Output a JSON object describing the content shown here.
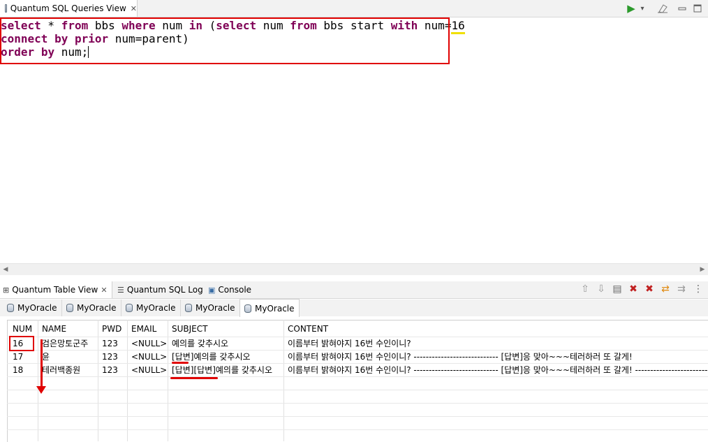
{
  "editor_tab": {
    "title": "Quantum SQL Queries View",
    "close": "✕"
  },
  "editor_toolbar": {
    "run": "▶",
    "dropdown": "▾",
    "clear": "🧹",
    "minimize": "▭",
    "maximize": "□"
  },
  "sql": {
    "line1": {
      "k1": "select",
      "t1": " * ",
      "k2": "from",
      "t2": " bbs ",
      "k3": "where",
      "t3": " num ",
      "k4": "in",
      "t4": " (",
      "k5": "select",
      "t5": " num ",
      "k6": "from",
      "t6": " bbs start ",
      "k7": "with",
      "t7": " num=",
      "num": "16"
    },
    "line2": {
      "k1": "connect",
      "t1": " ",
      "k2": "by",
      "t2": " ",
      "k3": "prior",
      "t3": " num=parent)"
    },
    "line3": {
      "k1": "order",
      "t1": " ",
      "k2": "by",
      "t2": " num;"
    }
  },
  "bottom_tabs": [
    {
      "label": "Quantum Table View",
      "icon": "table-icon",
      "close": "✕"
    },
    {
      "label": "Quantum SQL Log",
      "icon": "log-icon"
    },
    {
      "label": "Console",
      "icon": "console-icon"
    }
  ],
  "connection_tabs": [
    "MyOracle",
    "MyOracle",
    "MyOracle",
    "MyOracle",
    "MyOracle"
  ],
  "active_connection_tab": 4,
  "table": {
    "headers": [
      "NUM",
      "NAME",
      "PWD",
      "EMAIL",
      "SUBJECT",
      "CONTENT"
    ],
    "rows": [
      [
        "16",
        "검은망토군주",
        "123",
        "<NULL>",
        "예의를 갖추시오",
        "이름부터 밝혀야지 16번 수인이니?"
      ],
      [
        "17",
        "윤",
        "123",
        "<NULL>",
        "[답변]예의를 갖추시오",
        "이름부터 밝혀야지 16번 수인이니? ---------------------------- [답변]응 맞아~~~테러하러 또 갈게!"
      ],
      [
        "18",
        "테러백종원",
        "123",
        "<NULL>",
        "[답변][답변]예의를 갖추시오",
        "이름부터 밝혀야지 16번 수인이니? ---------------------------- [답변]응 맞아~~~테러하러 또 갈게! --------------------------------"
      ]
    ]
  },
  "colors": {
    "keyword": "#7f0055",
    "annotation": "#e00000"
  }
}
